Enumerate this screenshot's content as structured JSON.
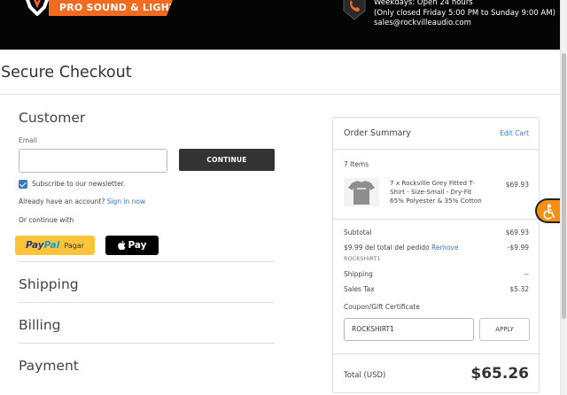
{
  "header": {
    "logo_tagline": "PRO SOUND & LIGHTING",
    "hours_line1": "Weekdays: Open 24 hours",
    "hours_line2": "(Only closed Friday 5:00 PM to Sunday 9:00 AM)",
    "email": "sales@rockvilleaudio.com"
  },
  "page": {
    "title": "Secure Checkout"
  },
  "customer": {
    "title": "Customer",
    "email_label": "Email",
    "email_value": "",
    "continue_label": "CONTINUE",
    "subscribe_label": "Subscribe to our newsletter.",
    "subscribe_checked": true,
    "account_prompt": "Already have an account?",
    "sign_in_label": "Sign in now",
    "or_continue": "Or continue with",
    "paypal": {
      "pay": "Pay",
      "pal": "Pal",
      "suffix": "Pagar"
    },
    "applepay_label": "Pay"
  },
  "steps": {
    "shipping": "Shipping",
    "billing": "Billing",
    "payment": "Payment"
  },
  "summary": {
    "title": "Order Summary",
    "edit_cart": "Edit Cart",
    "items_count": "7 Items",
    "item": {
      "description": "7 x Rockville Grey Fitted T-Shirt - Size-Small - Dry-Fit 65% Polyester & 35% Cotton",
      "price": "$69.93"
    },
    "subtotal_label": "Subtotal",
    "subtotal_value": "$69.93",
    "discount_label": "$9.99 del total del pedido",
    "discount_remove": "Remove",
    "discount_value": "-$9.99",
    "discount_code": "ROCKSHIRT1",
    "shipping_label": "Shipping",
    "shipping_value": "--",
    "tax_label": "Sales Tax",
    "tax_value": "$5.32",
    "coupon_label": "Coupon/Gift Certificate",
    "coupon_value": "ROCKSHIRT1",
    "apply_label": "APPLY",
    "total_label": "Total (USD)",
    "total_value": "$65.26"
  },
  "colors": {
    "accent": "#f36b21",
    "link": "#3778c3",
    "button_dark": "#333333",
    "paypal": "#ffc439",
    "a11y": "#f29111"
  },
  "icons": {
    "logo": "rockville-logo-icon",
    "clock": "clock-badge-icon",
    "check": "checkmark-icon",
    "apple": "apple-icon",
    "a11y": "accessibility-icon"
  }
}
